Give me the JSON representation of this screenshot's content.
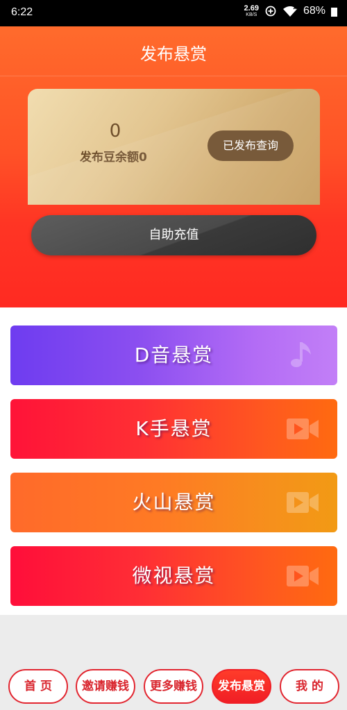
{
  "statusbar": {
    "time": "6:22",
    "speed_value": "2.69",
    "speed_unit": "KB/S",
    "battery": "68%"
  },
  "header": {
    "title": "发布悬赏"
  },
  "balance_card": {
    "amount": "0",
    "label": "发布豆余额0",
    "query_button": "已发布查询"
  },
  "recharge_button": "自助充值",
  "reward_cards": [
    {
      "label": "D音悬赏",
      "icon": "music-note-icon"
    },
    {
      "label": "K手悬赏",
      "icon": "video-camera-icon"
    },
    {
      "label": "火山悬赏",
      "icon": "video-camera-icon"
    },
    {
      "label": "微视悬赏",
      "icon": "video-camera-icon"
    }
  ],
  "bottom_nav": [
    {
      "label": "首 页"
    },
    {
      "label": "邀请赚钱"
    },
    {
      "label": "更多赚钱"
    },
    {
      "label": "发布悬赏",
      "active": true
    },
    {
      "label": "我 的"
    }
  ],
  "colors": {
    "header_orange": "#ff6b2c",
    "accent_red": "#e2252f",
    "gold": "#d2ad71",
    "brown": "#6d4d2a"
  }
}
